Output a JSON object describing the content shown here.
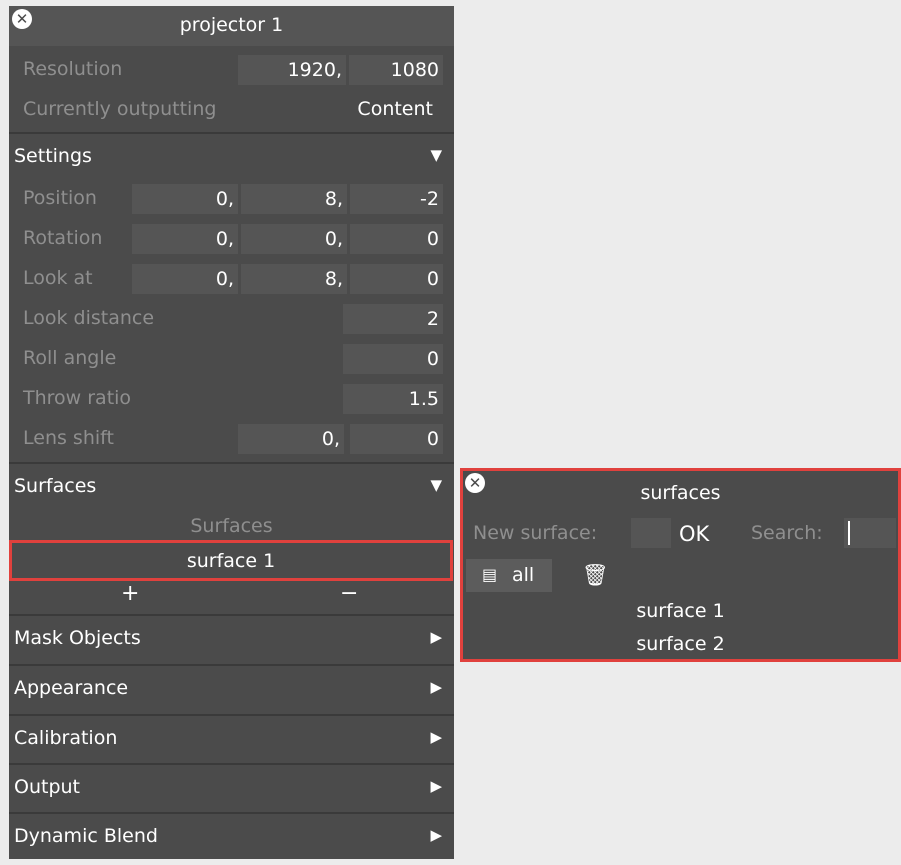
{
  "projector": {
    "close_icon": "x-circle-icon",
    "title": "projector 1",
    "resolution_label": "Resolution",
    "resolution_w": "1920,",
    "resolution_h": "1080",
    "outputting_label": "Currently outputting",
    "outputting_value": "Content",
    "settings": {
      "label": "Settings",
      "arrow": "▼",
      "position_label": "Position",
      "position": [
        "0,",
        "8,",
        "-2"
      ],
      "rotation_label": "Rotation",
      "rotation": [
        "0,",
        "0,",
        "0"
      ],
      "lookat_label": "Look at",
      "lookat": [
        "0,",
        "8,",
        "0"
      ],
      "lookdist_label": "Look distance",
      "lookdist": "2",
      "roll_label": "Roll angle",
      "roll": "0",
      "throw_label": "Throw ratio",
      "throw": "1.5",
      "lens_label": "Lens shift",
      "lens": [
        "0,",
        "0"
      ]
    },
    "surfaces": {
      "label": "Surfaces",
      "arrow": "▼",
      "list_header": "Surfaces",
      "items": [
        "surface 1"
      ],
      "add": "+",
      "remove": "−"
    },
    "sections": [
      {
        "label": "Mask Objects",
        "arrow": "▶"
      },
      {
        "label": "Appearance",
        "arrow": "▶"
      },
      {
        "label": "Calibration",
        "arrow": "▶"
      },
      {
        "label": "Output",
        "arrow": "▶"
      },
      {
        "label": "Dynamic Blend",
        "arrow": "▶"
      }
    ]
  },
  "surfaces_panel": {
    "close_icon": "x-circle-icon",
    "title": "surfaces",
    "new_surface_label": "New surface:",
    "ok": "OK",
    "search_label": "Search:",
    "all_label": "all",
    "all_icon": "list-icon",
    "trash_icon": "trash-icon",
    "items": [
      "surface 1",
      "surface 2"
    ]
  }
}
